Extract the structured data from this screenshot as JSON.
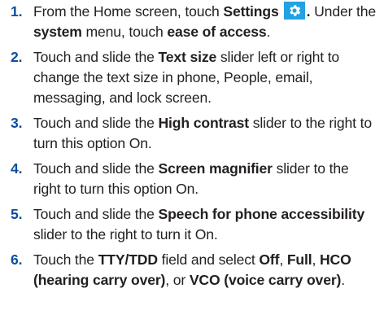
{
  "steps": [
    {
      "number": "1.",
      "segments": [
        {
          "text": "From the Home screen, touch ",
          "bold": false
        },
        {
          "text": "Settings",
          "bold": true
        },
        {
          "icon": "settings-gear-icon"
        },
        {
          "text": ".",
          "bold": true
        },
        {
          "text": " Under the ",
          "bold": false
        },
        {
          "text": "system",
          "bold": true
        },
        {
          "text": " menu, touch ",
          "bold": false
        },
        {
          "text": "ease of access",
          "bold": true
        },
        {
          "text": ".",
          "bold": false
        }
      ]
    },
    {
      "number": "2.",
      "segments": [
        {
          "text": "Touch and slide the ",
          "bold": false
        },
        {
          "text": "Text size",
          "bold": true
        },
        {
          "text": " slider left or right to change the text size in phone, People, email, messaging, and lock screen.",
          "bold": false
        }
      ]
    },
    {
      "number": "3.",
      "segments": [
        {
          "text": "Touch and slide the ",
          "bold": false
        },
        {
          "text": "High contrast",
          "bold": true
        },
        {
          "text": " slider to the right to turn this option On.",
          "bold": false
        }
      ]
    },
    {
      "number": "4.",
      "segments": [
        {
          "text": "Touch and slide the ",
          "bold": false
        },
        {
          "text": "Screen magnifier",
          "bold": true
        },
        {
          "text": " slider to the right to turn this option On.",
          "bold": false
        }
      ]
    },
    {
      "number": "5.",
      "segments": [
        {
          "text": "Touch and slide the ",
          "bold": false
        },
        {
          "text": "Speech for phone accessibility",
          "bold": true
        },
        {
          "text": " slider to the right to turn it On.",
          "bold": false
        }
      ]
    },
    {
      "number": "6.",
      "segments": [
        {
          "text": "Touch the ",
          "bold": false
        },
        {
          "text": "TTY/TDD",
          "bold": true
        },
        {
          "text": " field and select ",
          "bold": false
        },
        {
          "text": "Off",
          "bold": true
        },
        {
          "text": ", ",
          "bold": false
        },
        {
          "text": "Full",
          "bold": true
        },
        {
          "text": ", ",
          "bold": false
        },
        {
          "text": "HCO (hearing carry over)",
          "bold": true
        },
        {
          "text": ", or ",
          "bold": false
        },
        {
          "text": "VCO (voice carry over)",
          "bold": true
        },
        {
          "text": ".",
          "bold": false
        }
      ]
    }
  ],
  "colors": {
    "step_number": "#0b4ea2",
    "body_text": "#231f20",
    "settings_icon_bg": "#22a2e2",
    "settings_icon_fg": "#ffffff"
  }
}
